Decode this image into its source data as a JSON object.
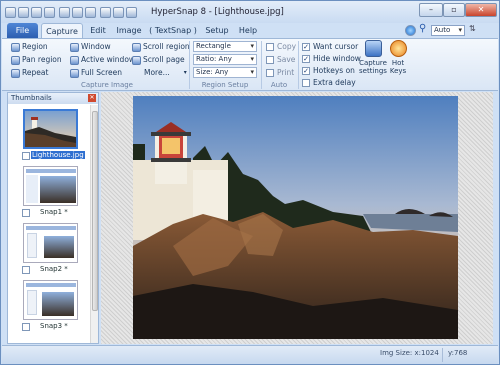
{
  "window": {
    "title": "HyperSnap 8 - [Lighthouse.jpg]",
    "zoom_select": "Auto"
  },
  "tabs": [
    "File",
    "Capture",
    "Edit",
    "Image",
    "( TextSnap )",
    "Setup",
    "Help"
  ],
  "ribbon": {
    "capture_image": {
      "label": "Capture Image",
      "col1": [
        "Region",
        "Pan region",
        "Repeat"
      ],
      "col2": [
        "Window",
        "Active window",
        "Full Screen"
      ],
      "col3": [
        "Scroll region",
        "Scroll page",
        "More..."
      ]
    },
    "region_setup": {
      "label": "Region Setup",
      "shape": "Rectangle",
      "ratio": "Ratio: Any",
      "size": "Size: Any"
    },
    "auto": {
      "label": "Auto",
      "items": [
        "Copy",
        "Save",
        "Print"
      ]
    },
    "options": {
      "items": [
        "Want cursor",
        "Hide window",
        "Hotkeys on",
        "Extra delay"
      ],
      "checked": [
        true,
        true,
        true,
        false
      ]
    },
    "big_buttons": {
      "capture_settings_line1": "Capture",
      "capture_settings_line2": "settings",
      "hot_keys_line1": "Hot",
      "hot_keys_line2": "Keys"
    }
  },
  "thumbnails": {
    "title": "Thumbnails",
    "items": [
      "Lighthouse.jpg",
      "Snap1 *",
      "Snap2 *",
      "Snap3 *"
    ]
  },
  "status": {
    "img_size": "Img Size:  x:1024",
    "y": "y:768"
  }
}
